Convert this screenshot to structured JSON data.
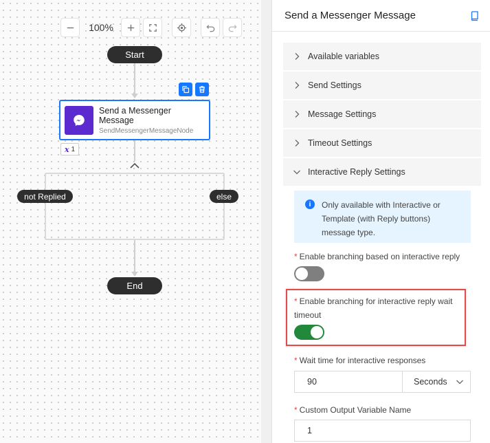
{
  "canvas": {
    "zoom_level": "100%",
    "start_label": "Start",
    "end_label": "End",
    "node": {
      "title": "Send a Messenger Message",
      "subtitle": "SendMessengerMessageNode",
      "variable_count": "1"
    },
    "branches": {
      "left": "not Replied",
      "right": "else"
    }
  },
  "panel": {
    "title": "Send a Messenger Message",
    "sections": [
      {
        "label": "Available variables",
        "expanded": false
      },
      {
        "label": "Send Settings",
        "expanded": false
      },
      {
        "label": "Message Settings",
        "expanded": false
      },
      {
        "label": "Timeout Settings",
        "expanded": false
      },
      {
        "label": "Interactive Reply Settings",
        "expanded": true
      }
    ],
    "info_text": "Only available with Interactive or Template (with Reply buttons) message type.",
    "fields": {
      "branching_reply": {
        "label": "Enable branching based on interactive reply",
        "enabled": false
      },
      "branching_timeout": {
        "label": "Enable branching for interactive reply wait timeout",
        "enabled": true
      },
      "wait_time": {
        "label": "Wait time for interactive responses",
        "value": "90",
        "unit": "Seconds"
      },
      "output_var": {
        "label": "Custom Output Variable Name",
        "value": "1"
      }
    }
  },
  "colors": {
    "accent": "#1677ff",
    "node_icon": "#5b2bd0",
    "toggle_on": "#22883c",
    "toggle_off": "#7f7f7f",
    "highlight": "#e04b4b",
    "required": "#e8454a"
  }
}
